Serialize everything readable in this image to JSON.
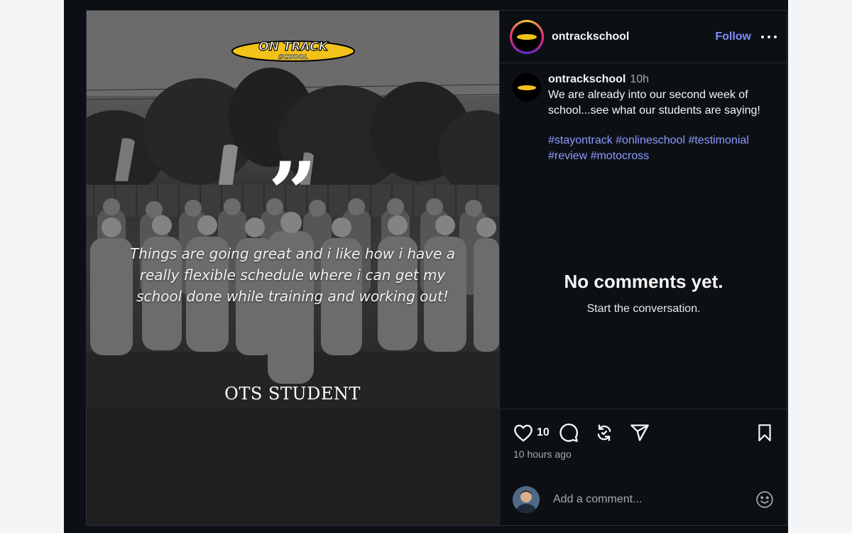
{
  "post": {
    "brand_logo": {
      "line1": "ON TRACK",
      "line2": "SCHOOL"
    },
    "quote": "Things are going great and i like how i have a really flexible schedule where i can get my school done while training and working out!",
    "author": "OTS STUDENT",
    "quote_mark_icon": "quote-icon"
  },
  "header": {
    "username": "ontrackschool",
    "follow_label": "Follow",
    "more_icon": "more-horizontal-icon"
  },
  "caption": {
    "username": "ontrackschool",
    "time": "10h",
    "text": "We are already into our second week of school...see what our students are saying!",
    "hashtags": "#stayontrack #onlineschool #testimonial #review #motocross"
  },
  "comments": {
    "empty_title": "No comments yet.",
    "empty_subtitle": "Start the conversation."
  },
  "actions": {
    "like_count": "10",
    "time_ago": "10 hours ago",
    "icons": [
      "heart-icon",
      "comment-icon",
      "repost-icon",
      "share-icon",
      "bookmark-icon"
    ]
  },
  "comment_box": {
    "placeholder": "Add a comment...",
    "emoji_icon": "emoji-icon"
  },
  "colors": {
    "background": "#0c1014",
    "accent_link": "#7f8cff",
    "hashtag": "#8c9bff",
    "logo_yellow": "#f2c21a"
  }
}
